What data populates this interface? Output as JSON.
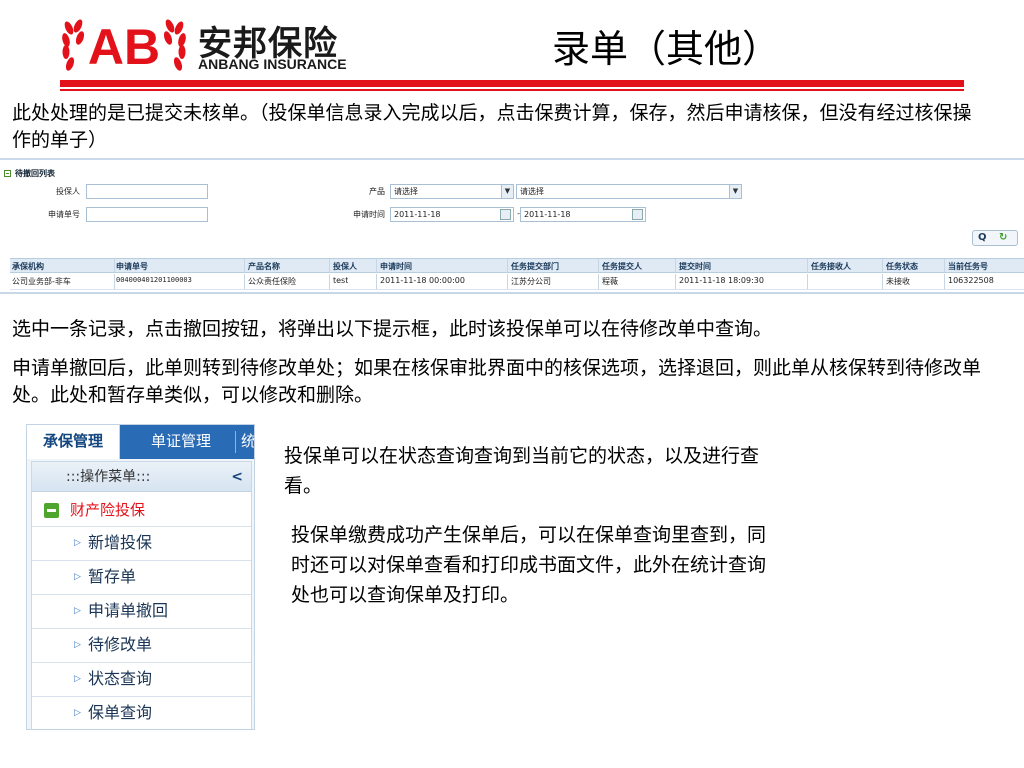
{
  "header": {
    "logo_cn": "安邦保险",
    "logo_en": "ANBANG INSURANCE",
    "logo_mark": "AB",
    "title": "录单（其他）"
  },
  "paragraphs": {
    "intro": "此处处理的是已提交未核单。（投保单信息录入完成以后，点击保费计算，保存，然后申请核保，但没有经过核保操作的单子）",
    "select_record": "选中一条记录，点击撤回按钮，将弹出以下提示框，此时该投保单可以在待修改单中查询。",
    "after_withdraw": "申请单撤回后，此单则转到待修改单处；如果在核保审批界面中的核保选项，选择退回，则此单从核保转到待修改单处。此处和暂存单类似，可以修改和删除。",
    "status_query": "投保单可以在状态查询查询到当前它的状态，以及进行查看。",
    "policy_query": "投保单缴费成功产生保单后，可以在保单查询里查到，同时还可以对保单查看和打印成书面文件，此外在统计查询处也可以查询保单及打印。"
  },
  "form": {
    "list_title": "待撤回列表",
    "applicant_label": "投保人",
    "applicant_value": "",
    "app_no_label": "申请单号",
    "app_no_value": "",
    "product_label": "产品",
    "product_select_1": "请选择",
    "product_select_2": "请选择",
    "apply_time_label": "申请时间",
    "date_from": "2011-11-18",
    "date_sep": "-",
    "date_to": "2011-11-18",
    "search_icon": "search-icon",
    "reset_icon": "refresh-icon"
  },
  "table": {
    "columns": [
      "承保机构",
      "申请单号",
      "产品名称",
      "投保人",
      "申请时间",
      "任务提交部门",
      "任务提交人",
      "提交时间",
      "任务接收人",
      "任务状态",
      "当前任务号"
    ],
    "rows": [
      [
        "公司业务部-非车",
        "004000401201100003",
        "公众责任保险",
        "test",
        "2011-11-18 00:00:00",
        "江苏分公司",
        "程薇",
        "2011-11-18 18:09:30",
        "",
        "未接收",
        "106322508"
      ]
    ]
  },
  "menu": {
    "tabs": [
      "承保管理",
      "单证管理",
      "统"
    ],
    "header": ":::操作菜单:::",
    "collapse_icon": "chevron-left-icon",
    "group": "财产险投保",
    "items": [
      "新增投保",
      "暂存单",
      "申请单撤回",
      "待修改单",
      "状态查询",
      "保单查询"
    ]
  },
  "colors": {
    "brand_red": "#e3121a",
    "menu_blue": "#2a6bb5",
    "group_green": "#4ea62f"
  }
}
